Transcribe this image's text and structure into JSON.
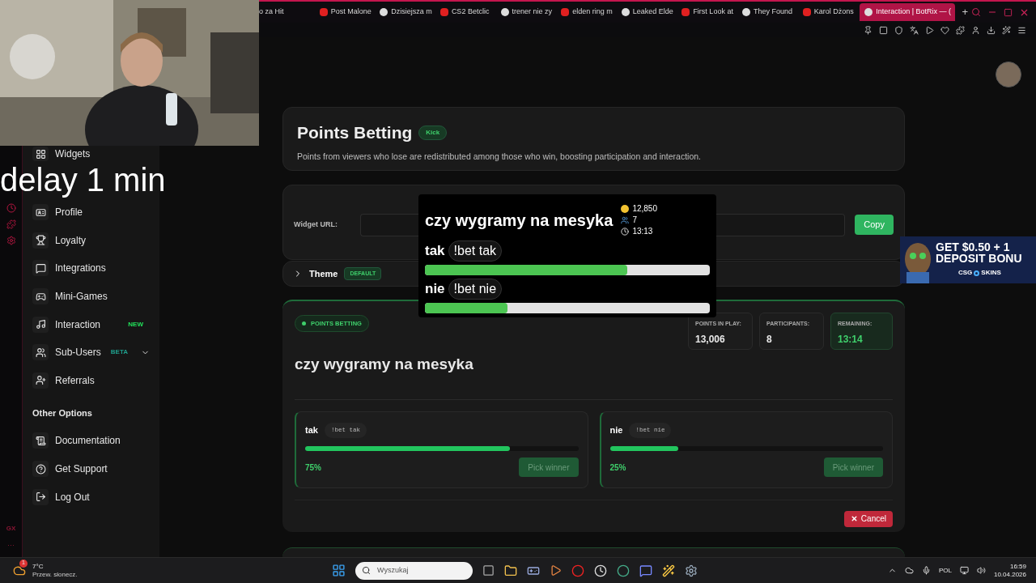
{
  "browser": {
    "tabs": [
      {
        "label": "o za Hit",
        "selected": false
      },
      {
        "label": "Post Malone",
        "selected": false
      },
      {
        "label": "Dzisiejsza m",
        "selected": false
      },
      {
        "label": "CS2 Betclic",
        "selected": false
      },
      {
        "label": "trener nie zy",
        "selected": false
      },
      {
        "label": "elden ring m",
        "selected": false
      },
      {
        "label": "Leaked Elde",
        "selected": false
      },
      {
        "label": "First Look at",
        "selected": false
      },
      {
        "label": "They Found",
        "selected": false
      },
      {
        "label": "Karol Dżons",
        "selected": false
      },
      {
        "label": "Interaction | BotRix — (",
        "selected": true
      }
    ],
    "new_tab": "+",
    "side_label": "GX",
    "side_more": "···"
  },
  "stream_overlay": {
    "caption": "delay 1 min"
  },
  "sidebar": {
    "items": [
      {
        "label": "Widgets"
      },
      {
        "label": "Profile"
      },
      {
        "label": "Loyalty"
      },
      {
        "label": "Integrations"
      },
      {
        "label": "Mini-Games"
      },
      {
        "label": "Interaction",
        "badge": "NEW"
      },
      {
        "label": "Sub-Users",
        "badge": "BETA",
        "expanded": false
      },
      {
        "label": "Referrals"
      }
    ],
    "other_heading": "Other Options",
    "other_items": [
      {
        "label": "Documentation"
      },
      {
        "label": "Get Support"
      },
      {
        "label": "Log Out"
      }
    ]
  },
  "header_card": {
    "title": "Points Betting",
    "tag": "Kick",
    "description": "Points from viewers who lose are redistributed among those who win, boosting participation and interaction."
  },
  "widget_url": {
    "label": "Widget URL:",
    "button": "Copy"
  },
  "theme": {
    "label": "Theme",
    "tag": "DEFAULT",
    "expanded": false
  },
  "betting": {
    "badge": "POINTS BETTING",
    "question": "czy wygramy na mesyka",
    "stats": [
      {
        "label": "POINTS IN PLAY:",
        "value": "13,006",
        "highlight": false
      },
      {
        "label": "PARTICIPANTS:",
        "value": "8",
        "highlight": false
      },
      {
        "label": "REMAINING:",
        "value": "13:14",
        "highlight": true
      }
    ],
    "options": [
      {
        "name": "tak",
        "command": "!bet tak",
        "level": 0.75,
        "percent": "75%",
        "button": "Pick winner",
        "disabled": true
      },
      {
        "name": "nie",
        "command": "!bet nie",
        "level": 0.25,
        "percent": "25%",
        "button": "Pick winner",
        "disabled": true
      }
    ],
    "cancel": "Cancel"
  },
  "widget_preview": {
    "question": "czy wygramy na mesyka",
    "points": "12,850",
    "participants": "7",
    "time": "13:13",
    "options": [
      {
        "name": "tak",
        "command": "!bet tak",
        "level": 0.71
      },
      {
        "name": "nie",
        "command": "!bet nie",
        "level": 0.29
      }
    ]
  },
  "ad": {
    "line_1": "GET $0.50 + 1",
    "line_2": "DEPOSIT BONU",
    "brand_1": "CSG",
    "brand_2": "SKINS"
  },
  "taskbar": {
    "weather_badge": "1",
    "temperature": "7°C",
    "condition": "Przew. słonecz.",
    "search_placeholder": "Wyszukaj",
    "language": "POL",
    "time": "16:59",
    "date": "10.04.2026"
  }
}
